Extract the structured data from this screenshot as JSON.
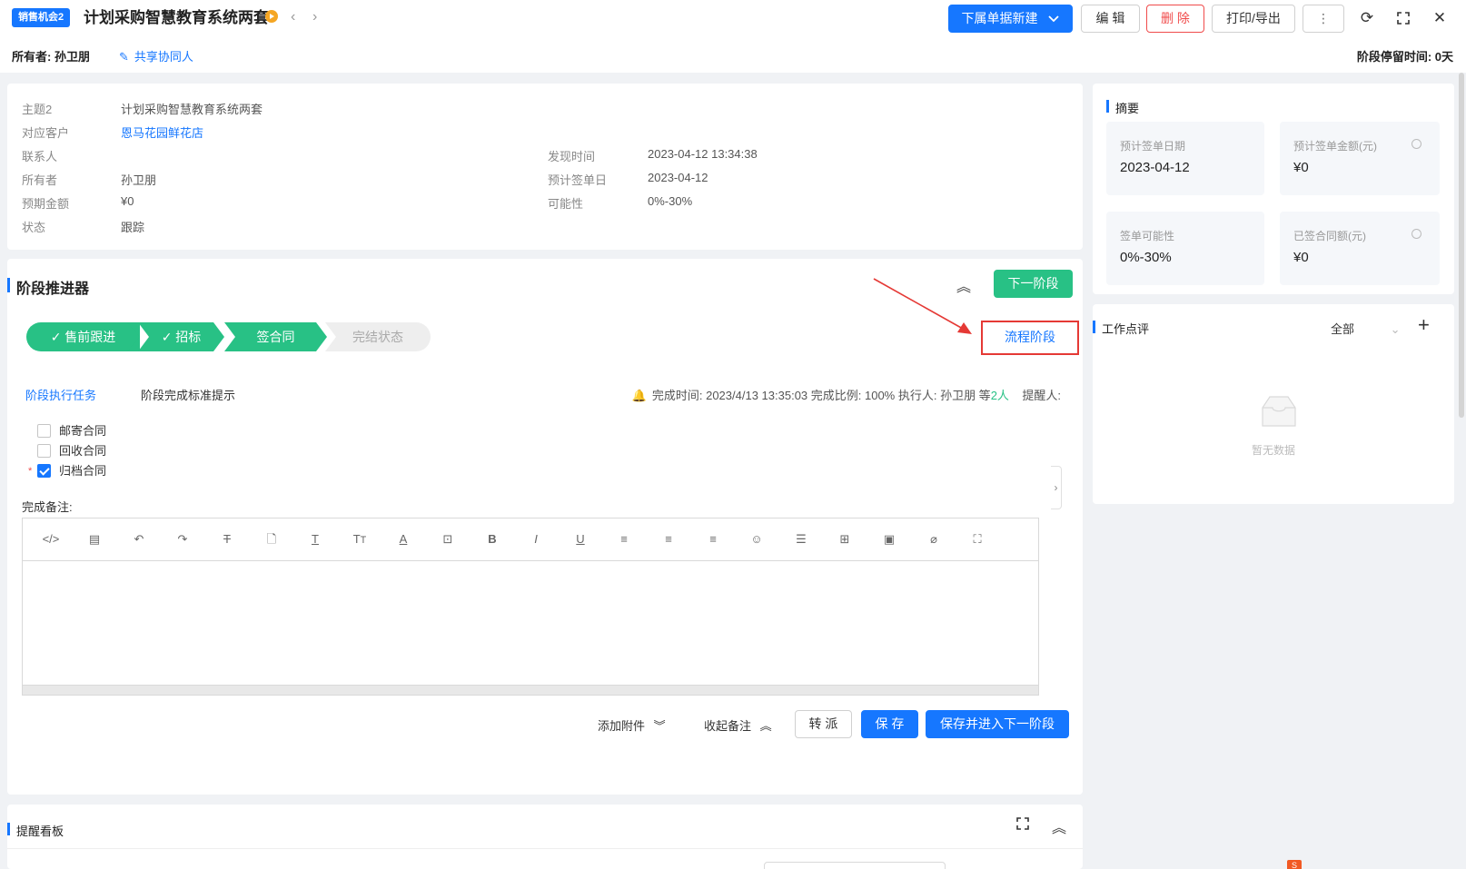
{
  "header": {
    "badge": "销售机会2",
    "title": "计划采购智慧教育系统两套",
    "prev_icon": "‹",
    "next_icon": "›",
    "owner_text": "所有者: 孙卫朋",
    "share_text": "共享协同人",
    "stay_time": "阶段停留时间: 0天",
    "buttons": {
      "new_sub": "下属单据新建",
      "edit": "编 辑",
      "delete": "删 除",
      "print_export": "打印/导出"
    },
    "icons": {
      "more": "⋮",
      "refresh": "⟳",
      "fullscreen": "⛶",
      "close": "✕"
    }
  },
  "info": {
    "fields_left": [
      {
        "label": "主题2",
        "value": "计划采购智慧教育系统两套"
      },
      {
        "label": "对应客户",
        "value": "恩马花园鲜花店"
      },
      {
        "label": "联系人",
        "value": ""
      },
      {
        "label": "所有者",
        "value": "孙卫朋"
      },
      {
        "label": "预期金额",
        "value": "¥0"
      },
      {
        "label": "状态",
        "value": "跟踪"
      }
    ],
    "fields_right": [
      {
        "label": "发现时间",
        "value": "2023-04-12 13:34:38"
      },
      {
        "label": "预计签单日",
        "value": "2023-04-12"
      },
      {
        "label": "可能性",
        "value": "0%-30%"
      }
    ]
  },
  "stage": {
    "title": "阶段推进器",
    "next_btn": "下一阶段",
    "flow_btn": "流程阶段",
    "collapse_icon": "︽",
    "stages": [
      {
        "label": "✓ 售前跟进",
        "done": true
      },
      {
        "label": "✓ 招标",
        "done": true
      },
      {
        "label": "签合同",
        "done": true
      },
      {
        "label": "完结状态",
        "done": false
      }
    ],
    "tabs": [
      "阶段执行任务",
      "阶段完成标准提示"
    ],
    "meta_prefix": "完成时间: 2023/4/13 13:35:03    完成比例: 100%    执行人: 孙卫朋 等",
    "meta_count": "2人",
    "meta_reminder": "提醒人:",
    "tasks": [
      {
        "label": "邮寄合同",
        "checked": false,
        "required": false
      },
      {
        "label": "回收合同",
        "checked": false,
        "required": false
      },
      {
        "label": "归档合同",
        "checked": true,
        "required": true
      }
    ],
    "remark_label": "完成备注:",
    "footer": {
      "attach": "添加附件",
      "collapse_remark": "收起备注",
      "transfer": "转 派",
      "save": "保 存",
      "save_next": "保存并进入下一阶段"
    }
  },
  "summary": {
    "title": "摘要",
    "items": [
      {
        "label": "预计签单日期",
        "value": "2023-04-12"
      },
      {
        "label": "预计签单金额(元)",
        "value": "¥0"
      },
      {
        "label": "签单可能性",
        "value": "0%-30%"
      },
      {
        "label": "已签合同额(元)",
        "value": "¥0"
      }
    ]
  },
  "comments": {
    "title": "工作点评",
    "filter": "全部",
    "add_icon": "+",
    "empty": "暂无数据"
  },
  "reminder": {
    "title": "提醒看板"
  },
  "colors": {
    "primary": "#1677ff",
    "green": "#28c185",
    "danger": "#f04b4b",
    "annotation": "#e53935"
  }
}
